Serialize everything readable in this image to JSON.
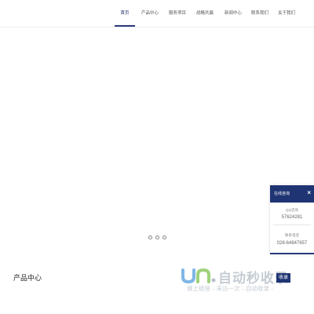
{
  "nav": {
    "items": [
      {
        "label": "首页"
      },
      {
        "label": "产品中心"
      },
      {
        "label": "服务项目"
      },
      {
        "label": "战略共赢"
      },
      {
        "label": "新闻中心"
      },
      {
        "label": "联系我们"
      },
      {
        "label": "关于我们"
      }
    ],
    "active_index": 0
  },
  "section": {
    "title": "产品中心"
  },
  "consult": {
    "title": "在线咨询",
    "close": "×",
    "qq_label": "QQ咨询",
    "qq_value": "57624281",
    "phone_label": "联系电话",
    "phone_value": "028-64847657"
  },
  "watermark": {
    "text": "自动秒收录",
    "sub": "做上链接→来访一次→自动收录→",
    "arrow": "收录"
  },
  "colors": {
    "accent": "#1f3473",
    "watermark_blue": "#7fb6e6"
  }
}
